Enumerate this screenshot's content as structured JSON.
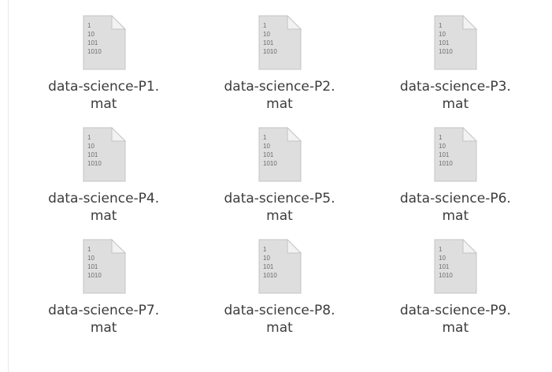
{
  "files": [
    {
      "name": "data-science-P1.",
      "ext": "mat"
    },
    {
      "name": "data-science-P2.",
      "ext": "mat"
    },
    {
      "name": "data-science-P3.",
      "ext": "mat"
    },
    {
      "name": "data-science-P4.",
      "ext": "mat"
    },
    {
      "name": "data-science-P5.",
      "ext": "mat"
    },
    {
      "name": "data-science-P6.",
      "ext": "mat"
    },
    {
      "name": "data-science-P7.",
      "ext": "mat"
    },
    {
      "name": "data-science-P8.",
      "ext": "mat"
    },
    {
      "name": "data-science-P9.",
      "ext": "mat"
    }
  ],
  "icon": {
    "name": "binary-file-icon",
    "lines": [
      "1",
      "10",
      "101",
      "1010"
    ],
    "paper_color": "#dedede",
    "fold_color": "#f2f2f2",
    "text_color": "#6d6d6d"
  }
}
